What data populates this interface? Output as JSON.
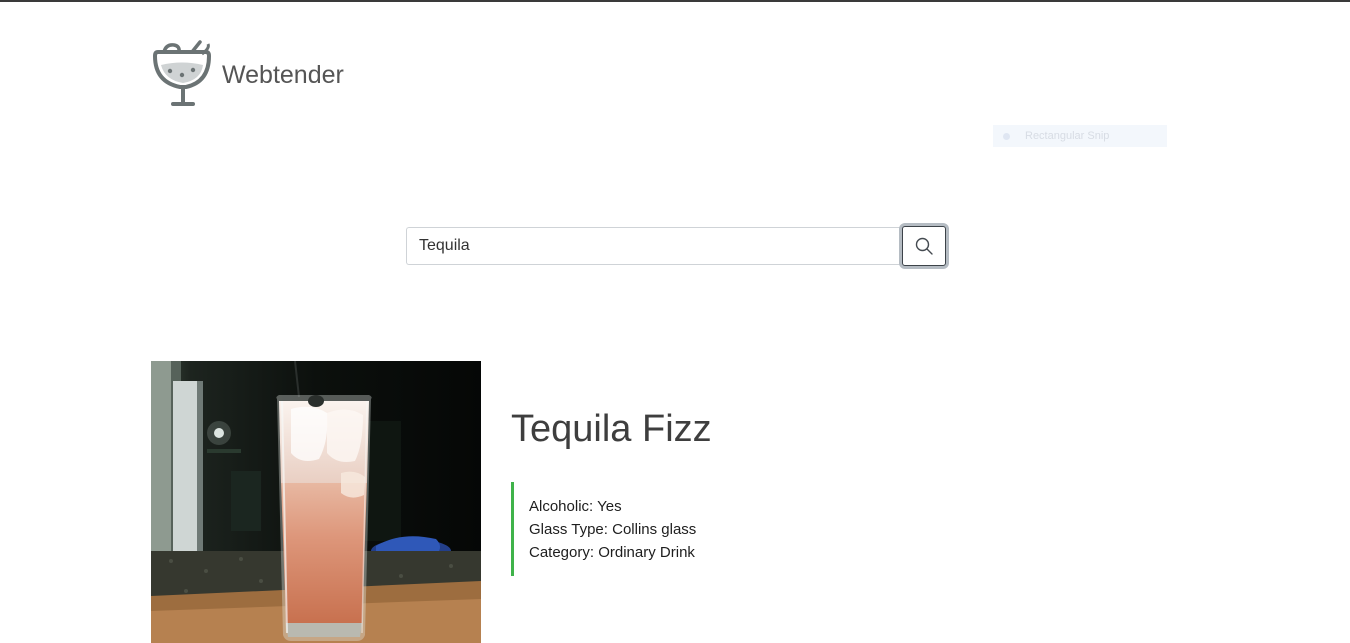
{
  "header": {
    "brand_name": "Webtender",
    "logo_icon": "cocktail-glass-icon"
  },
  "overlay": {
    "snip_label": "Rectangular Snip"
  },
  "search": {
    "value": "Tequila",
    "button_icon": "search-icon"
  },
  "result": {
    "image_alt": "photo of a tall collins glass with orange-pink drink and ice",
    "name": "Tequila Fizz",
    "details": [
      {
        "label": "Alcoholic:",
        "value": "Yes"
      },
      {
        "label": "Glass Type:",
        "value": "Collins glass"
      },
      {
        "label": "Category:",
        "value": "Ordinary Drink"
      }
    ]
  },
  "colors": {
    "accent_green": "#3fb34a",
    "text_dark": "#3e3e3e",
    "logo_gray": "#6b7374"
  }
}
